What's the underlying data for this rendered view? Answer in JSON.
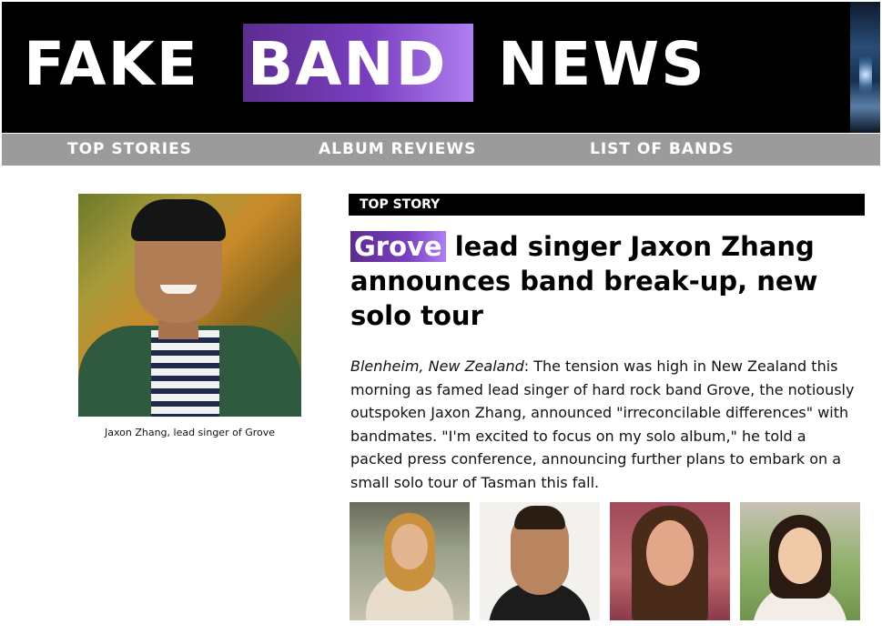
{
  "header": {
    "logo_word_1": "FAKE",
    "logo_word_2": "BAND",
    "logo_word_3": "NEWS",
    "accent_gradient": [
      "#5b2d8e",
      "#b07ff0"
    ]
  },
  "nav": {
    "items": [
      {
        "label": "TOP STORIES"
      },
      {
        "label": "ALBUM REVIEWS"
      },
      {
        "label": "LIST OF BANDS"
      }
    ]
  },
  "main_photo": {
    "caption": "Jaxon Zhang, lead singer of Grove"
  },
  "story": {
    "section_label": "TOP STORY",
    "headline_band": "Grove",
    "headline_rest": " lead singer Jaxon Zhang announces band break-up, new solo tour",
    "dateline": "Blenheim, New Zealand",
    "body": ": The tension was high in New Zealand this morning as famed lead singer of hard rock band Grove, the notiously outspoken Jaxon Zhang, announced \"irreconcilable differences\" with bandmates. \"I'm excited to focus on my solo album,\" he told a packed press conference, announcing further plans to embark on a small solo tour of Tasman this fall."
  },
  "colors": {
    "header_bg": "#000000",
    "nav_bg": "#9b9b9b",
    "text": "#111111"
  }
}
